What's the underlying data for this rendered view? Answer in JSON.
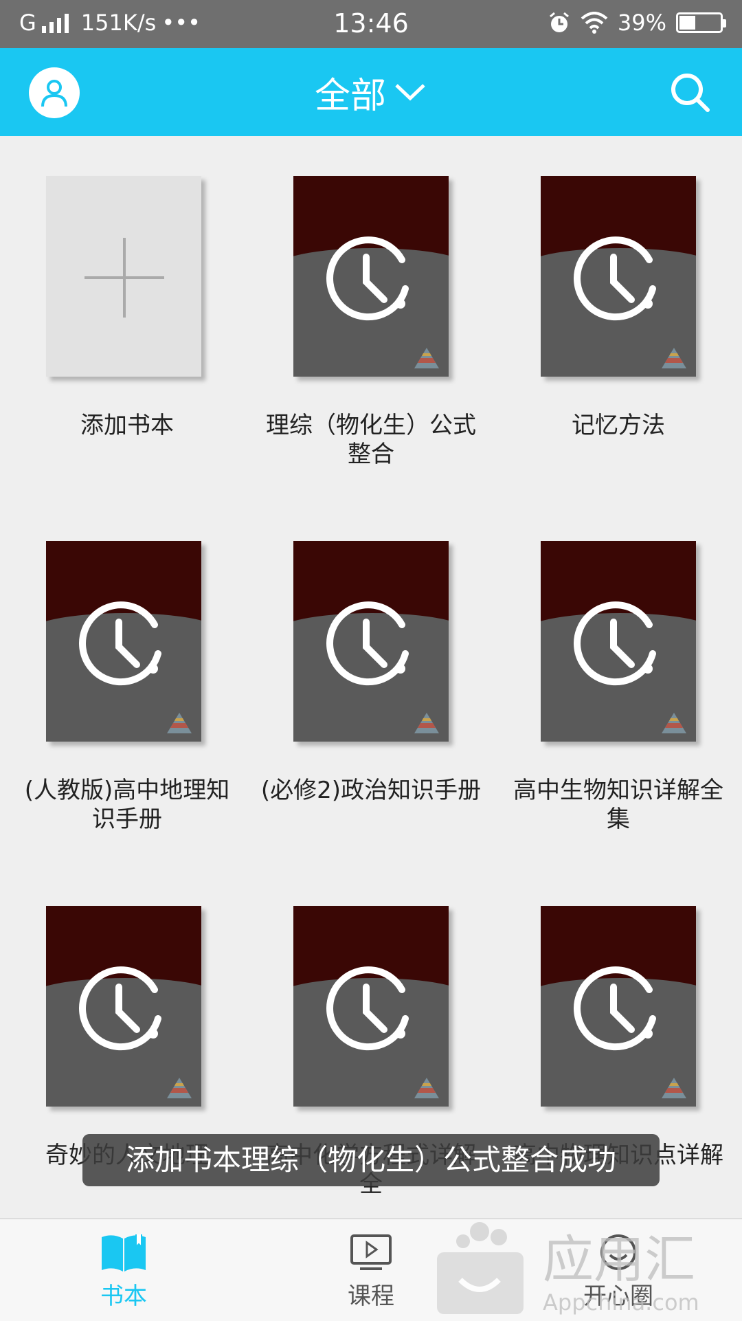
{
  "status_bar": {
    "network": "G",
    "speed": "151K/s",
    "dots": "•••",
    "time": "13:46",
    "battery_text": "39%",
    "battery_level": 0.39
  },
  "header": {
    "title": "全部",
    "avatar_icon": "user-icon",
    "dropdown_icon": "chevron-down-icon",
    "search_icon": "search-icon",
    "accent_color": "#1ac7f2"
  },
  "books": [
    {
      "label": "添加书本",
      "type": "add"
    },
    {
      "label": "理综（物化生）公式整合",
      "type": "book"
    },
    {
      "label": "记忆方法",
      "type": "book"
    },
    {
      "label": "(人教版)高中地理知识手册",
      "type": "book"
    },
    {
      "label": "(必修2)政治知识手册",
      "type": "book"
    },
    {
      "label": "高中生物知识详解全集",
      "type": "book"
    },
    {
      "label": "奇妙的人文地理",
      "type": "book"
    },
    {
      "label": "高中化学方程式详解全",
      "type": "book"
    },
    {
      "label": "高中物理知识点详解",
      "type": "book"
    }
  ],
  "toast": {
    "text": "添加书本理综（物化生）公式整合成功"
  },
  "bottom_nav": {
    "items": [
      {
        "label": "书本",
        "icon": "book-icon",
        "active": true
      },
      {
        "label": "课程",
        "icon": "video-course-icon",
        "active": false
      },
      {
        "label": "开心圈",
        "icon": "happy-circle-icon",
        "active": false
      }
    ]
  },
  "watermark": {
    "brand": "应用汇",
    "site": "Appchina.com"
  }
}
